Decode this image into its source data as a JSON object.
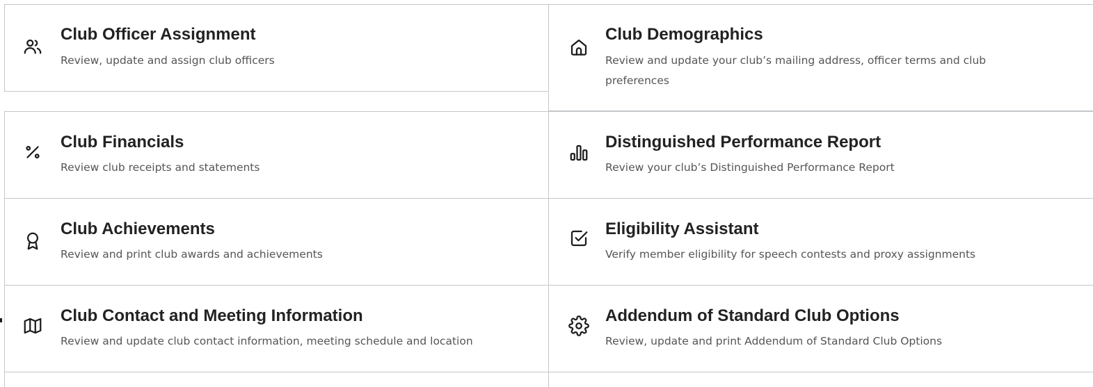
{
  "cards": [
    {
      "id": "officer",
      "title": "Club Officer Assignment",
      "description": "Review, update and assign club officers",
      "icon": "users-icon"
    },
    {
      "id": "demographics",
      "title": "Club Demographics",
      "description": "Review and update your club’s mailing address, officer terms and club preferences",
      "icon": "home-icon"
    },
    {
      "id": "financials",
      "title": "Club Financials",
      "description": "Review club receipts and statements",
      "icon": "percent-icon"
    },
    {
      "id": "dpr",
      "title": "Distinguished Performance Report",
      "description": "Review your club’s Distinguished Performance Report",
      "icon": "bar-chart-icon"
    },
    {
      "id": "achievements",
      "title": "Club Achievements",
      "description": "Review and print club awards and achievements",
      "icon": "award-icon"
    },
    {
      "id": "eligibility",
      "title": "Eligibility Assistant",
      "description": "Verify member eligibility for speech contests and proxy assignments",
      "icon": "checkbox-icon"
    },
    {
      "id": "contact",
      "title": "Club Contact and Meeting Information",
      "description": "Review and update club contact information, meeting schedule and location",
      "icon": "map-icon"
    },
    {
      "id": "addendum",
      "title": "Addendum of Standard Club Options",
      "description": "Review, update and print Addendum of Standard Club Options",
      "icon": "gear-icon"
    }
  ],
  "colors": {
    "border": "#c4c7c9",
    "title": "#222222",
    "description": "#555555",
    "icon": "#1b1b1b"
  }
}
